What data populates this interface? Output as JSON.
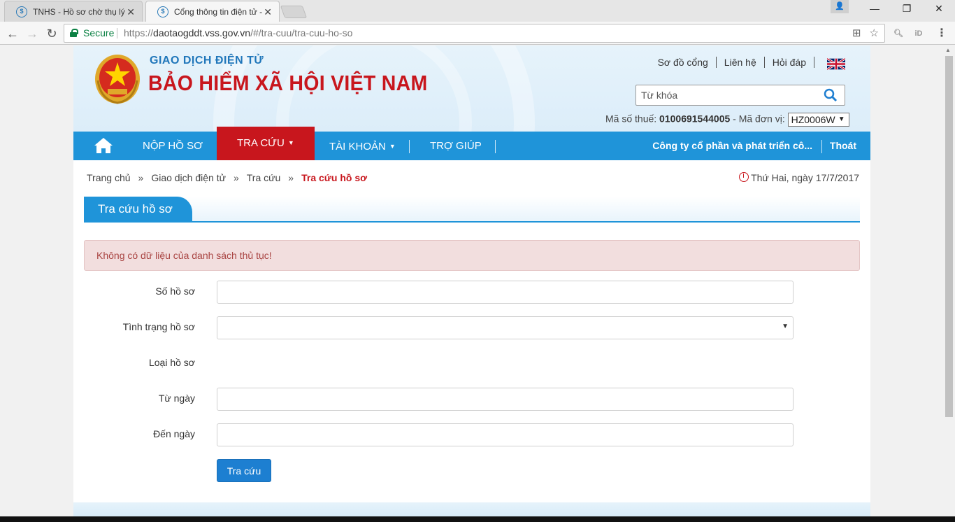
{
  "browser": {
    "tabs": [
      {
        "title": "TNHS - Hồ sơ chờ thụ lý",
        "active": false
      },
      {
        "title": "Cổng thông tin điện tử -",
        "active": true
      }
    ],
    "address": {
      "secure_label": "Secure",
      "url_scheme": "https://",
      "url_host": "daotaogddt.vss.gov.vn",
      "url_path": "/#/tra-cuu/tra-cuu-ho-so"
    },
    "extensions": [
      "search-ext",
      "iD"
    ]
  },
  "header": {
    "subtitle": "GIAO DỊCH ĐIỆN TỬ",
    "title": "BẢO HIỂM XÃ HỘI VIỆT NAM",
    "top_links": [
      "Sơ đồ cổng",
      "Liên hệ",
      "Hỏi đáp"
    ],
    "search_placeholder": "Từ khóa",
    "tax_label": "Mã số thuế:",
    "tax_value": "0100691544005",
    "unit_label": "- Mã đơn vị:",
    "unit_value": "HZ0006W"
  },
  "nav": {
    "items": [
      {
        "label": "NỘP HỒ SƠ",
        "dropdown": false
      },
      {
        "label": "TRA CỨU",
        "dropdown": true,
        "active": true
      },
      {
        "label": "TÀI KHOẢN",
        "dropdown": true
      },
      {
        "label": "TRỢ GIÚP",
        "dropdown": false
      }
    ],
    "company": "Công ty cổ phần và phát triển cô...",
    "logout": "Thoát"
  },
  "breadcrumb": [
    "Trang chủ",
    "Giao dịch điện tử",
    "Tra cứu",
    "Tra cứu hồ sơ"
  ],
  "date": "Thứ Hai, ngày 17/7/2017",
  "panel": {
    "title": "Tra cứu hồ sơ"
  },
  "alert": "Không có dữ liệu của danh sách thủ tục!",
  "form": {
    "so_ho_so": {
      "label": "Số hồ sơ",
      "value": ""
    },
    "tinh_trang": {
      "label": "Tình trạng hồ sơ",
      "value": ""
    },
    "loai_ho_so": {
      "label": "Loại hồ sơ"
    },
    "tu_ngay": {
      "label": "Từ ngày",
      "value": ""
    },
    "den_ngay": {
      "label": "Đến ngày",
      "value": ""
    },
    "submit_label": "Tra cứu"
  },
  "colors": {
    "brand_red": "#c8161d",
    "brand_blue": "#1f94d9",
    "alert_bg": "#f2dede",
    "button_blue": "#1d7fd1"
  }
}
